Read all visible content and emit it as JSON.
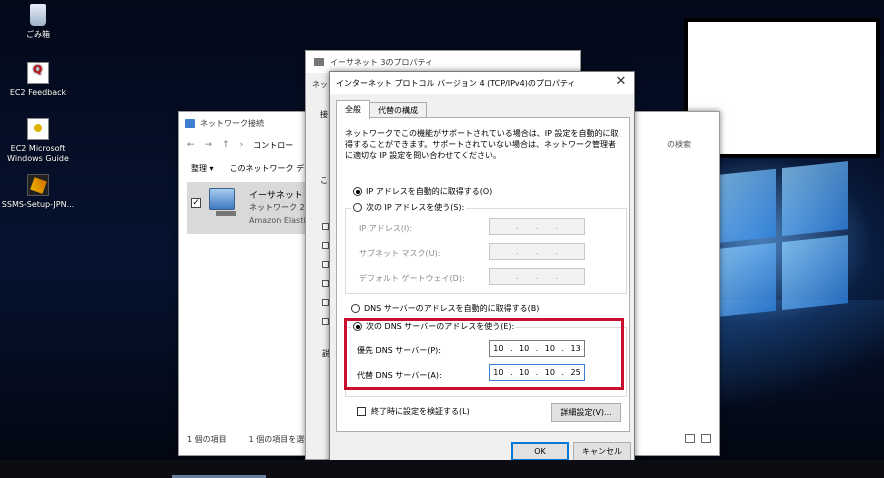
{
  "desktop": {
    "icons": [
      {
        "label": "ごみ箱",
        "icon": "recycle-bin-icon"
      },
      {
        "label": "EC2 Feedback",
        "icon": "document-icon"
      },
      {
        "label": "EC2 Microsoft Windows Guide",
        "icon": "document-icon"
      },
      {
        "label": "SSMS-Setup-JPN...",
        "icon": "installer-icon"
      }
    ]
  },
  "network_window": {
    "title": "ネットワーク接続",
    "breadcrumb": "コントロー",
    "toolbar": {
      "organize": "整理 ▾",
      "disable": "このネットワーク デバイ"
    },
    "search_hint": "の検索",
    "adapter": {
      "name": "イーサネット 3",
      "network": "ネットワーク 2",
      "device": "Amazon Elastic N"
    },
    "status_left": "1 個の項目",
    "status_selected": "1 個の項目を選択"
  },
  "ethernet_window": {
    "title": "イーサネット 3のプロパティ",
    "tab": "ネッ",
    "frag1": "接",
    "frag2": "こ",
    "frag3": "説"
  },
  "ipv4_dialog": {
    "title": "インターネット プロトコル バージョン 4 (TCP/IPv4)のプロパティ",
    "close": "✕",
    "tabs": {
      "general": "全般",
      "alternate": "代替の構成"
    },
    "description": "ネットワークでこの機能がサポートされている場合は、IP 設定を自動的に取得することができます。サポートされていない場合は、ネットワーク管理者に適切な IP 設定を問い合わせてください。",
    "ip_auto": "IP アドレスを自動的に取得する(O)",
    "ip_manual": "次の IP アドレスを使う(S):",
    "ip_address_label": "IP アドレス(I):",
    "subnet_label": "サブネット マスク(U):",
    "gateway_label": "デフォルト ゲートウェイ(D):",
    "dot": ".",
    "dns_auto": "DNS サーバーのアドレスを自動的に取得する(B)",
    "dns_manual": "次の DNS サーバーのアドレスを使う(E):",
    "preferred_dns_label": "優先 DNS サーバー(P):",
    "alternate_dns_label": "代替 DNS サーバー(A):",
    "preferred_dns": [
      "10",
      "10",
      "10",
      "13"
    ],
    "alternate_dns": [
      "10",
      "10",
      "10",
      "25"
    ],
    "validate_on_exit": "終了時に設定を検証する(L)",
    "advanced_button": "詳細設定(V)...",
    "ok_button": "OK",
    "cancel_button": "キャンセル"
  },
  "colors": {
    "highlight_box": "#c8102e",
    "default_button_border": "#0078d7"
  }
}
